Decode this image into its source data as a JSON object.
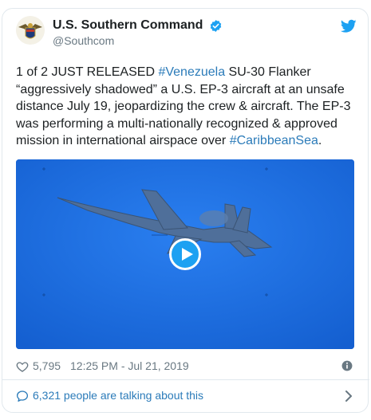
{
  "tweet": {
    "display_name": "U.S. Southern Command",
    "handle": "@Southcom",
    "text_parts": [
      {
        "t": "1 of 2 JUST RELEASED ",
        "link": false
      },
      {
        "t": "#Venezuela",
        "link": true
      },
      {
        "t": " SU-30 Flanker “aggressively shadowed” a U.S. EP-3 aircraft at an unsafe distance July 19, jeopardizing the crew & aircraft. The EP-3 was performing a multi-nationally recognized & approved mission in international airspace over ",
        "link": false
      },
      {
        "t": "#CaribbeanSea",
        "link": true
      },
      {
        "t": ".",
        "link": false
      }
    ],
    "likes": "5,795",
    "timestamp": "12:25 PM - Jul 21, 2019",
    "talking": "6,321 people are talking about this"
  },
  "icons": {
    "avatar": "southcom-seal",
    "verified": "verified-badge-icon",
    "brand": "twitter-bird-icon",
    "like": "heart-icon",
    "info": "info-icon",
    "reply": "speech-bubble-icon",
    "more": "chevron-right-icon",
    "play": "play-icon"
  },
  "colors": {
    "link": "#2b7bb9",
    "twitter_blue": "#1da1f2",
    "text": "#1c2022",
    "muted": "#697882",
    "sky": "#1d6fe0"
  }
}
